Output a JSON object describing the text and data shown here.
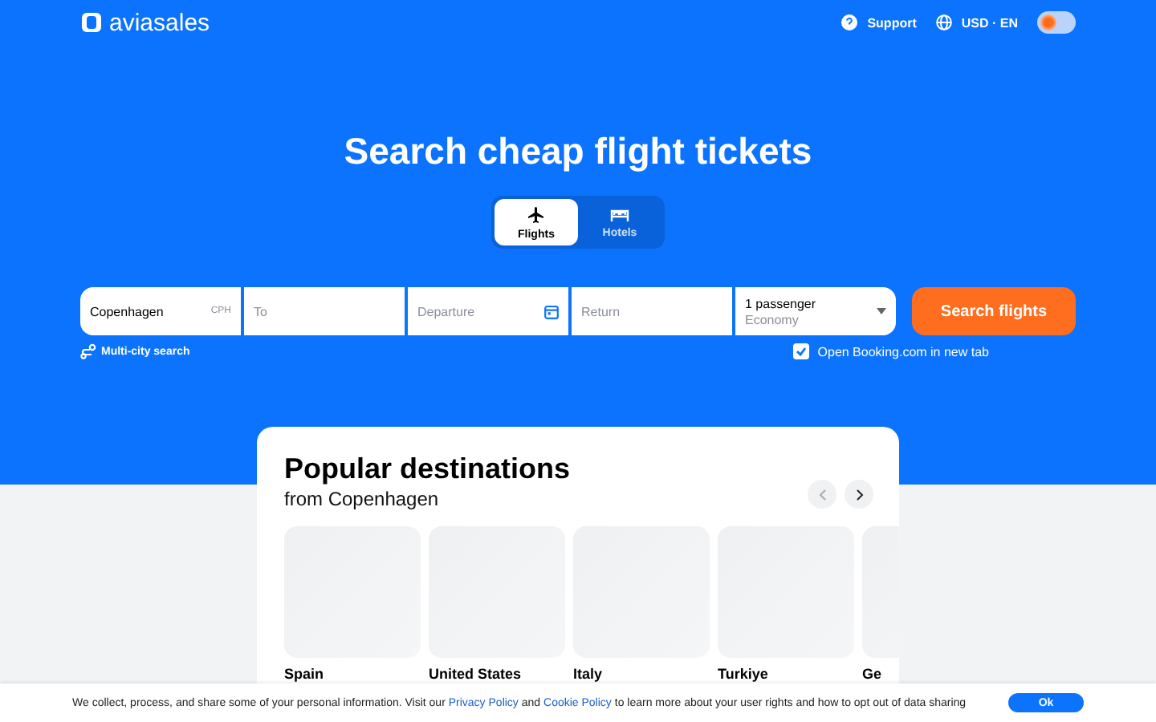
{
  "header": {
    "logo": "aviasales",
    "support": "Support",
    "locale": "USD · EN",
    "dark_mode": false
  },
  "hero": {
    "title": "Search cheap flight tickets"
  },
  "tabs": [
    {
      "label": "Flights",
      "kind": "plane",
      "selected": true
    },
    {
      "label": "Hotels",
      "kind": "bed",
      "selected": false
    }
  ],
  "search": {
    "fields": [
      {
        "kind": "city",
        "value": "Copenhagen",
        "code": "CPH"
      },
      {
        "kind": "city",
        "placeholder": "To"
      },
      {
        "kind": "date",
        "placeholder": "Departure"
      },
      {
        "kind": "plain",
        "placeholder": "Return"
      },
      {
        "kind": "passengers",
        "value": "1 passenger",
        "sub": "Economy"
      }
    ],
    "button": "Search flights",
    "multi_city": "Multi-city search",
    "open_booking": {
      "label": "Open Booking.com in new tab",
      "checked": true
    }
  },
  "popular": {
    "title": "Popular destinations",
    "subtitle": "from Copenhagen",
    "destinations": [
      {
        "name": "Spain"
      },
      {
        "name": "United States"
      },
      {
        "name": "Italy"
      },
      {
        "name": "Turkiye"
      },
      {
        "name": "Ge"
      }
    ]
  },
  "cookie": {
    "parts": [
      {
        "kind": "text",
        "text": "We collect, process, and share some of your personal information. Visit our "
      },
      {
        "kind": "link",
        "text": "Privacy Policy"
      },
      {
        "kind": "text",
        "text": " and "
      },
      {
        "kind": "link",
        "text": "Cookie Policy"
      },
      {
        "kind": "text",
        "text": " to learn more about your user rights and how to opt out of data sharing"
      }
    ],
    "button": "Ok"
  }
}
